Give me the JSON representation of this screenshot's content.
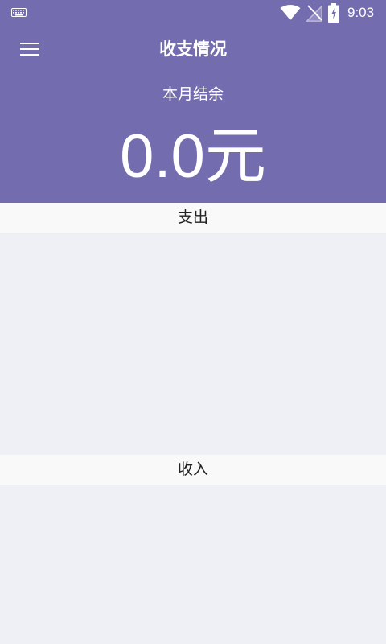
{
  "status_bar": {
    "time": "9:03",
    "icons": [
      "keyboard-icon",
      "wifi-icon",
      "no-signal-icon",
      "battery-charging-icon"
    ]
  },
  "app_bar": {
    "menu_icon": "menu-icon",
    "title": "收支情况"
  },
  "summary": {
    "label": "本月结余",
    "balance": "0.0元"
  },
  "sections": {
    "expense": {
      "title": "支出"
    },
    "income": {
      "title": "收入"
    }
  },
  "colors": {
    "primary": "#736cae",
    "background": "#eff0f5",
    "section_header": "#f9f9fa"
  }
}
